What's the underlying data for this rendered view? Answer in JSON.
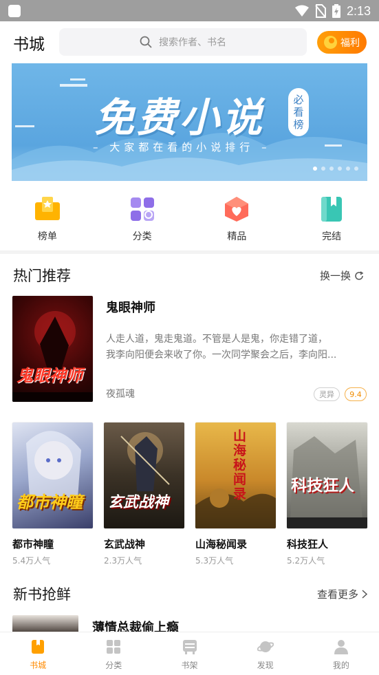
{
  "status_bar": {
    "time": "2:13"
  },
  "header": {
    "title": "书城",
    "search_placeholder": "搜索作者、书名",
    "welfare_label": "福利"
  },
  "banner": {
    "title": "免费小说",
    "badge": [
      "必",
      "看",
      "榜"
    ],
    "subtitle": "大家都在看的小说排行",
    "slide_index": 1,
    "slide_count": 6
  },
  "quick_nav": [
    {
      "label": "榜单",
      "icon": "ranking-icon"
    },
    {
      "label": "分类",
      "icon": "category-icon"
    },
    {
      "label": "精品",
      "icon": "boutique-icon"
    },
    {
      "label": "完结",
      "icon": "finished-icon"
    }
  ],
  "hot": {
    "title": "热门推荐",
    "refresh_label": "换一换",
    "featured": {
      "title": "鬼眼神师",
      "desc_line1": "人走人道，鬼走鬼道。不管是人是鬼，你走错了道，",
      "desc_line2": "我李向阳便会来收了你。一次同学聚会之后，李向阳...",
      "author": "夜孤魂",
      "genre": "灵异",
      "score": "9.4",
      "cover_text": "鬼眼神师"
    },
    "books": [
      {
        "title": "都市神瞳",
        "popularity": "5.4万人气",
        "cover_text": "都市神瞳"
      },
      {
        "title": "玄武战神",
        "popularity": "2.3万人气",
        "cover_text": "玄武战神"
      },
      {
        "title": "山海秘闻录",
        "popularity": "5.3万人气",
        "cover_text": "山海秘闻录"
      },
      {
        "title": "科技狂人",
        "popularity": "5.2万人气",
        "cover_text": "科技狂人"
      }
    ]
  },
  "new_books": {
    "title": "新书抢鲜",
    "more_label": "查看更多",
    "first_title": "薄情总裁偷上瘾"
  },
  "tabbar": [
    {
      "label": "书城",
      "icon": "bookstore-icon",
      "active": true
    },
    {
      "label": "分类",
      "icon": "category-grid-icon",
      "active": false
    },
    {
      "label": "书架",
      "icon": "bookshelf-icon",
      "active": false
    },
    {
      "label": "发现",
      "icon": "planet-icon",
      "active": false
    },
    {
      "label": "我的",
      "icon": "profile-icon",
      "active": false
    }
  ],
  "colors": {
    "accent": "#ff8a00",
    "banner": "#5aa5df"
  }
}
